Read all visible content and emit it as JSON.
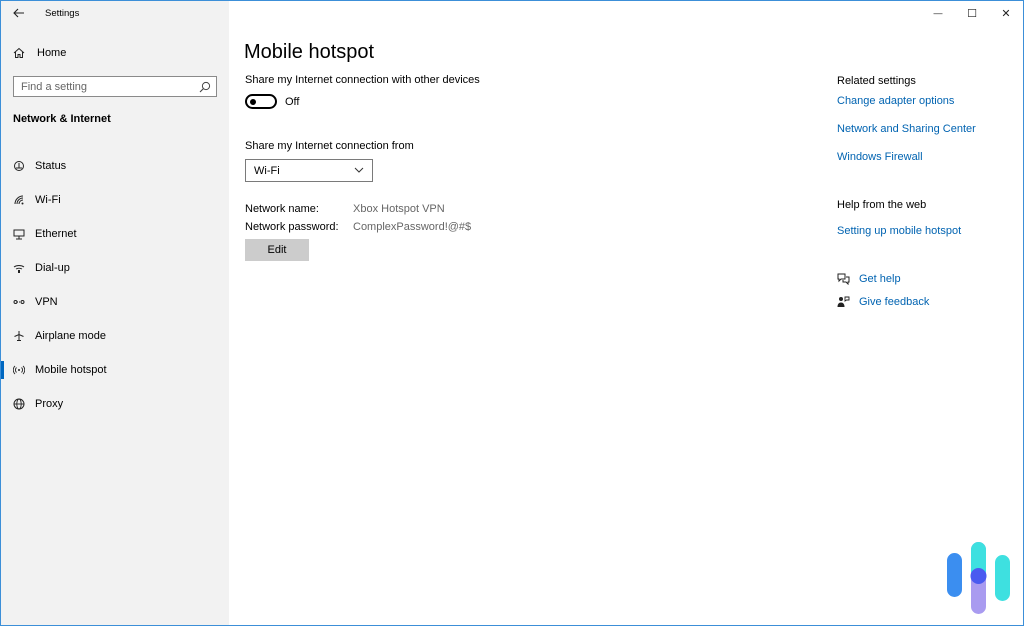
{
  "window": {
    "app_title": "Settings",
    "controls": {
      "minimize": "—",
      "maximize": "☐",
      "close": "✕"
    }
  },
  "sidebar": {
    "home_label": "Home",
    "search_placeholder": "Find a setting",
    "section_title": "Network & Internet",
    "items": [
      {
        "label": "Status",
        "icon": "status-icon",
        "active": false
      },
      {
        "label": "Wi-Fi",
        "icon": "wifi-icon",
        "active": false
      },
      {
        "label": "Ethernet",
        "icon": "ethernet-icon",
        "active": false
      },
      {
        "label": "Dial-up",
        "icon": "dialup-icon",
        "active": false
      },
      {
        "label": "VPN",
        "icon": "vpn-icon",
        "active": false
      },
      {
        "label": "Airplane mode",
        "icon": "airplane-icon",
        "active": false
      },
      {
        "label": "Mobile hotspot",
        "icon": "hotspot-icon",
        "active": true
      },
      {
        "label": "Proxy",
        "icon": "globe-icon",
        "active": false
      }
    ]
  },
  "main": {
    "title": "Mobile hotspot",
    "share_label": "Share my Internet connection with other devices",
    "toggle_state": "Off",
    "share_from_label": "Share my Internet connection from",
    "share_from_value": "Wi-Fi",
    "network_name_label": "Network name:",
    "network_name_value": "Xbox Hotspot VPN",
    "network_password_label": "Network password:",
    "network_password_value": "ComplexPassword!@#$",
    "edit_label": "Edit"
  },
  "right": {
    "related_title": "Related settings",
    "related_links": [
      "Change adapter options",
      "Network and Sharing Center",
      "Windows Firewall"
    ],
    "help_title": "Help from the web",
    "help_links": [
      "Setting up mobile hotspot"
    ],
    "get_help": "Get help",
    "give_feedback": "Give feedback"
  },
  "colors": {
    "accent": "#0067c0",
    "link": "#0063b1",
    "sidebar_bg": "#f2f2f2",
    "window_border": "#3c8fd8",
    "logo_blue": "#3b8ef0",
    "logo_cyan": "#3ee0e0",
    "logo_purple": "#a99bf0",
    "logo_dot": "#4a5bf0"
  }
}
